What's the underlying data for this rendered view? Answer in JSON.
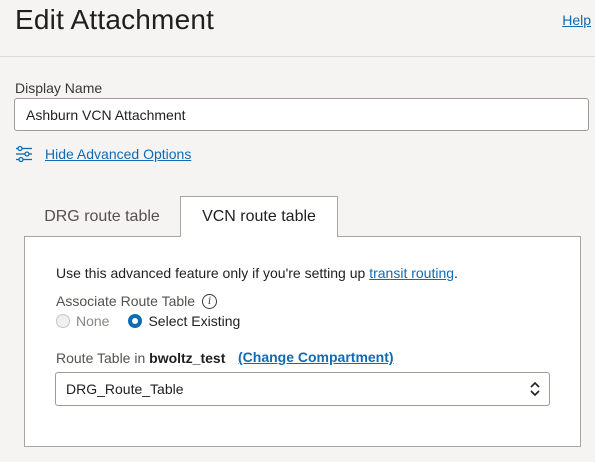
{
  "header": {
    "title": "Edit Attachment",
    "help_label": "Help"
  },
  "form": {
    "display_name_label": "Display Name",
    "display_name_value": "Ashburn VCN Attachment",
    "advanced_toggle_icon": "sliders-icon",
    "advanced_toggle_label": "Hide Advanced Options"
  },
  "tabs": [
    {
      "label": "DRG route table",
      "active": false
    },
    {
      "label": "VCN route table",
      "active": true
    }
  ],
  "panel": {
    "intro_text": "Use this advanced feature only if you're setting up ",
    "intro_link": "transit routing",
    "intro_suffix": ".",
    "associate_label": "Associate Route Table",
    "info_icon": "info-icon",
    "radio_options": [
      {
        "label": "None",
        "checked": false,
        "disabled": true
      },
      {
        "label": "Select Existing",
        "checked": true,
        "disabled": false
      }
    ],
    "route_table_label_prefix": "Route Table in ",
    "compartment_name": "bwoltz_test",
    "change_compartment_label": "(Change Compartment)",
    "route_table_value": "DRG_Route_Table",
    "select_icon": "chevron-updown-icon"
  },
  "colors": {
    "accent": "#0f6bb5",
    "page_bg": "#f5f4f2",
    "border": "#a8a49f"
  }
}
